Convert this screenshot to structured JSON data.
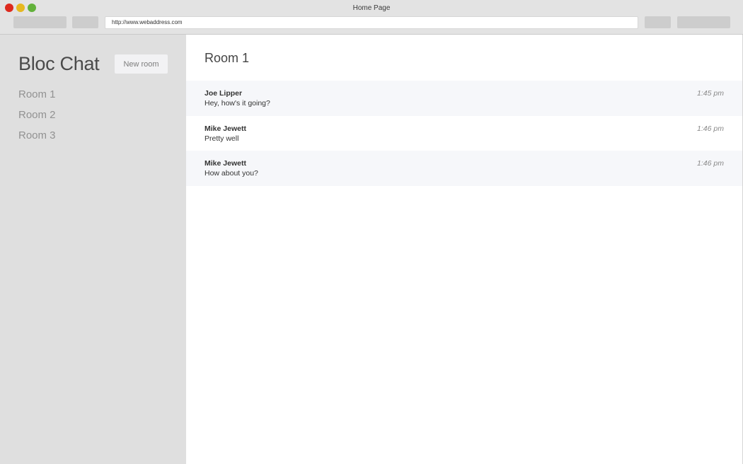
{
  "window": {
    "title": "Home Page"
  },
  "browser": {
    "url": "http://www.webaddress.com"
  },
  "sidebar": {
    "app_title": "Bloc Chat",
    "new_room_label": "New room",
    "rooms": [
      {
        "label": "Room 1"
      },
      {
        "label": "Room 2"
      },
      {
        "label": "Room 3"
      }
    ]
  },
  "main": {
    "room_title": "Room 1",
    "messages": [
      {
        "user": "Joe Lipper",
        "text": "Hey, how's it going?",
        "time": "1:45 pm"
      },
      {
        "user": "Mike Jewett",
        "text": "Pretty well",
        "time": "1:46 pm"
      },
      {
        "user": "Mike Jewett",
        "text": "How about you?",
        "time": "1:46 pm"
      }
    ]
  },
  "colors": {
    "traffic_close": "#dd2a1e",
    "traffic_minimize": "#e6b820",
    "traffic_maximize": "#62b13a",
    "sidebar_bg": "#dfdfdf",
    "message_alt_bg": "#f6f7fa"
  }
}
